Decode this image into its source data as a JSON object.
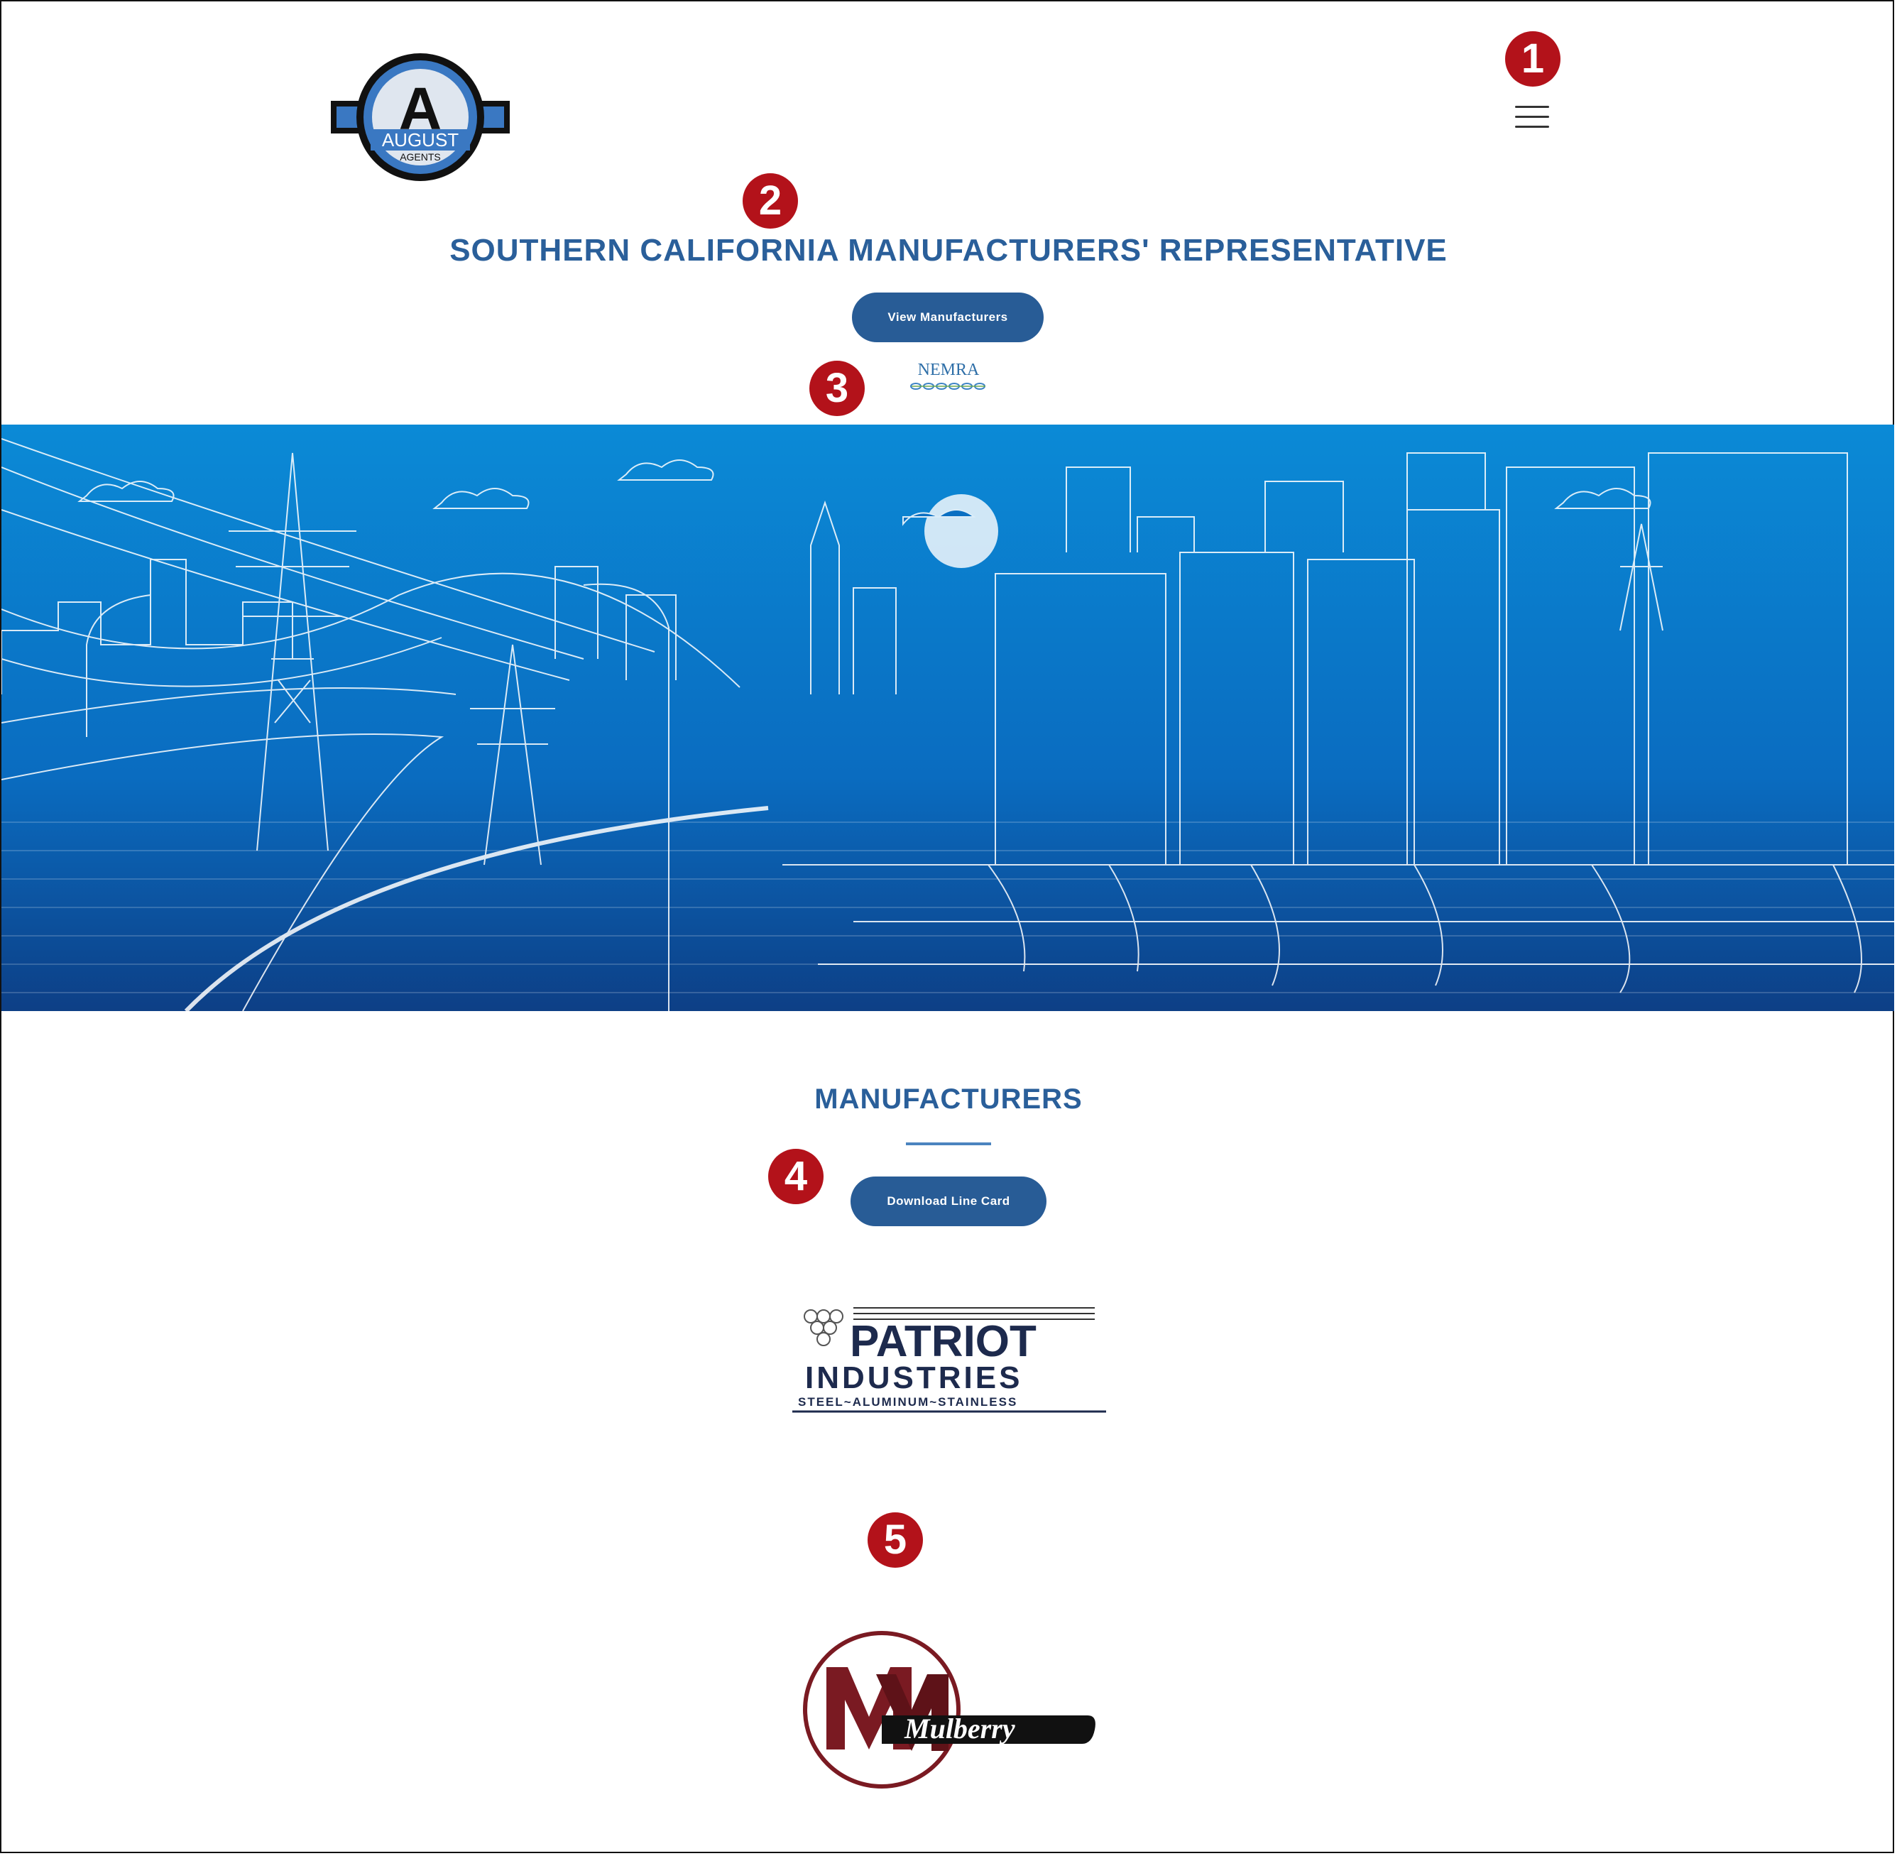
{
  "header": {
    "logo_letter": "A",
    "logo_name": "AUGUST",
    "logo_sub": "AGENTS",
    "menu_icon": "hamburger-menu-icon"
  },
  "hero": {
    "title": "SOUTHERN CALIFORNIA MANUFACTURERS' REPRESENTATIVE",
    "view_button": "View Manufacturers",
    "nemra_logo_text": "NEMRA"
  },
  "banner": {
    "description_icon": "city-power-dam-illustration"
  },
  "manufacturers": {
    "heading": "MANUFACTURERS",
    "download_button": "Download Line Card",
    "items": [
      {
        "name": "PATRIOT",
        "line2": "INDUSTRIES",
        "tagline": "STEEL~ALUMINUM~STAINLESS"
      },
      {
        "name": "Mulberry"
      }
    ]
  },
  "markers": [
    "1",
    "2",
    "3",
    "4",
    "5"
  ],
  "colors": {
    "brand_blue": "#2a5f9a",
    "button_blue": "#285c96",
    "marker_red": "#b3121a",
    "banner_top": "#0b8ad6",
    "banner_bottom": "#0d3f86"
  }
}
